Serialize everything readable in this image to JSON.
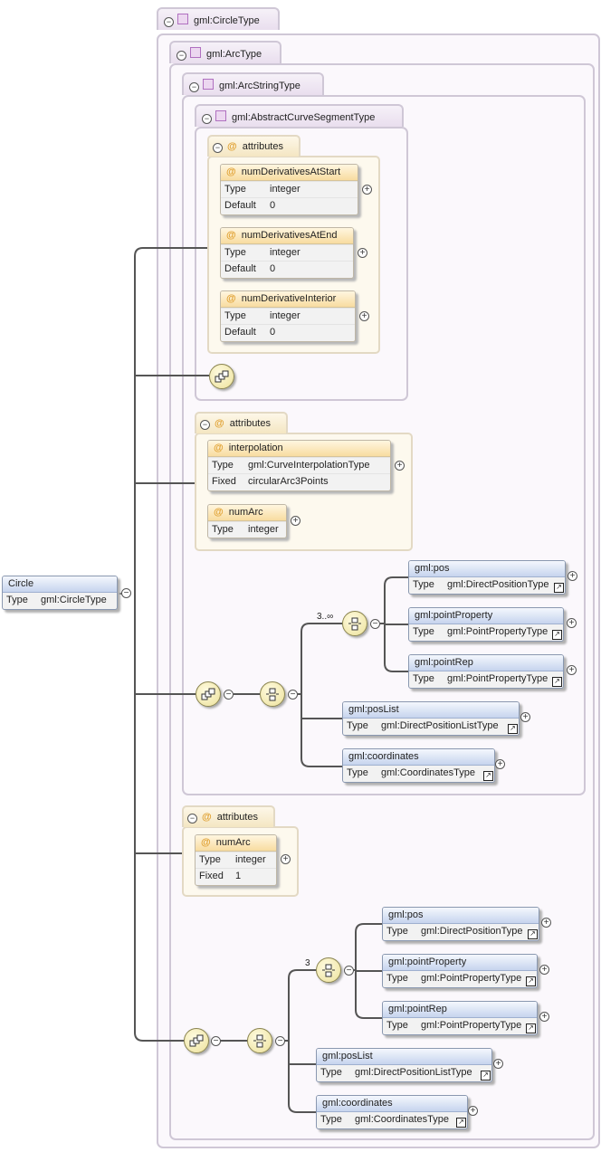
{
  "root": {
    "name": "Circle",
    "type_key": "Type",
    "type_value": "gml:CircleType"
  },
  "types": {
    "circle": "gml:CircleType",
    "arc": "gml:ArcType",
    "arcstring": "gml:ArcStringType",
    "abstract": "gml:AbstractCurveSegmentType"
  },
  "attr_group_label": "attributes",
  "labels": {
    "type": "Type",
    "default": "Default",
    "fixed": "Fixed"
  },
  "abstract_attrs": [
    {
      "name": "numDerivativesAtStart",
      "type": "integer",
      "default": "0"
    },
    {
      "name": "numDerivativesAtEnd",
      "type": "integer",
      "default": "0"
    },
    {
      "name": "numDerivativeInterior",
      "type": "integer",
      "default": "0"
    }
  ],
  "arcstring_attrs": {
    "interpolation": {
      "name": "interpolation",
      "type": "gml:CurveInterpolationType",
      "fixed": "circularArc3Points"
    },
    "numArc": {
      "name": "numArc",
      "type": "integer"
    }
  },
  "arc_attrs": {
    "numArc": {
      "name": "numArc",
      "type": "integer",
      "fixed": "1"
    }
  },
  "occurrence": {
    "arcstring": "3..∞",
    "arc": "3"
  },
  "elements": {
    "pos": {
      "name": "gml:pos",
      "type": "gml:DirectPositionType"
    },
    "pointProperty": {
      "name": "gml:pointProperty",
      "type": "gml:PointPropertyType"
    },
    "pointRep": {
      "name": "gml:pointRep",
      "type": "gml:PointPropertyType"
    },
    "posList": {
      "name": "gml:posList",
      "type": "gml:DirectPositionListType"
    },
    "coordinates": {
      "name": "gml:coordinates",
      "type": "gml:CoordinatesType"
    }
  },
  "icons": {
    "collapse": "−",
    "expand": "+",
    "link": "↗",
    "attribute": "@"
  }
}
